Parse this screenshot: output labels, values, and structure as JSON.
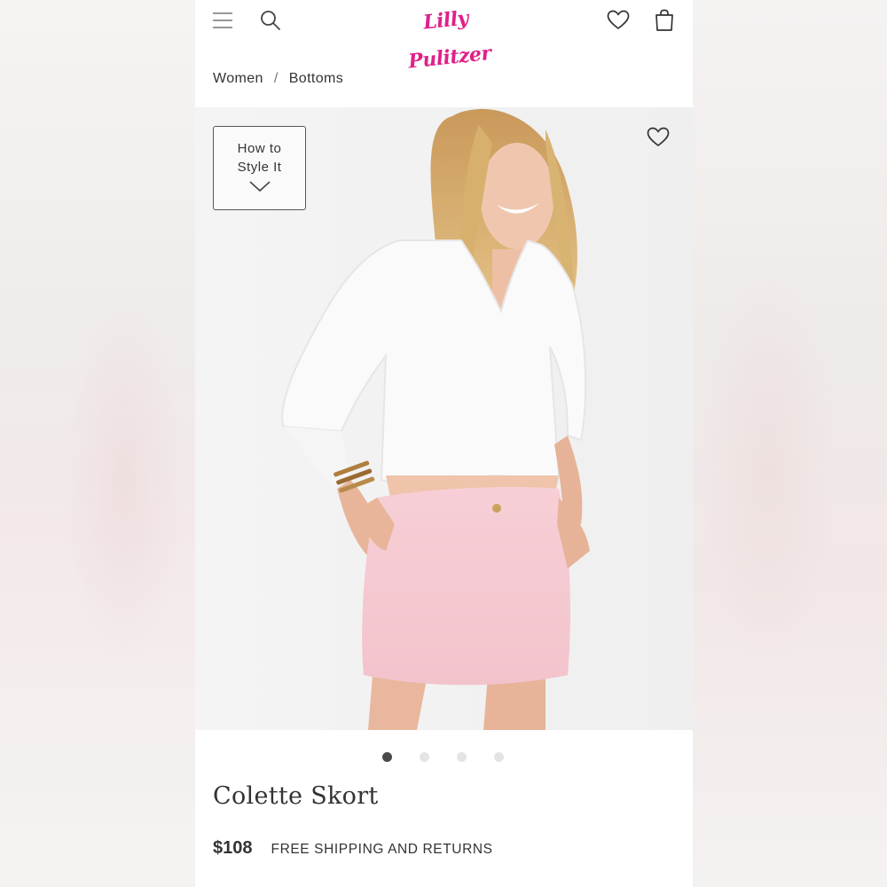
{
  "header": {
    "logo_text": "Lilly Pulitzer",
    "brand_color": "#e0208a",
    "icons": [
      "menu-icon",
      "search-icon",
      "heart-icon",
      "shopping-bag-icon"
    ]
  },
  "breadcrumb": {
    "items": [
      "Women",
      "Bottoms"
    ],
    "separator": "/"
  },
  "hero": {
    "style_button": {
      "line1": "How to",
      "line2": "Style It"
    },
    "image_alt": "Model wearing white linen shirt and pink skort"
  },
  "carousel": {
    "total": 4,
    "active_index": 0
  },
  "product": {
    "title": "Colette Skort",
    "price": "$108",
    "shipping": "FREE SHIPPING AND RETURNS"
  },
  "colors": {
    "skort_pink": "#f6cbd2",
    "text": "#333333"
  }
}
